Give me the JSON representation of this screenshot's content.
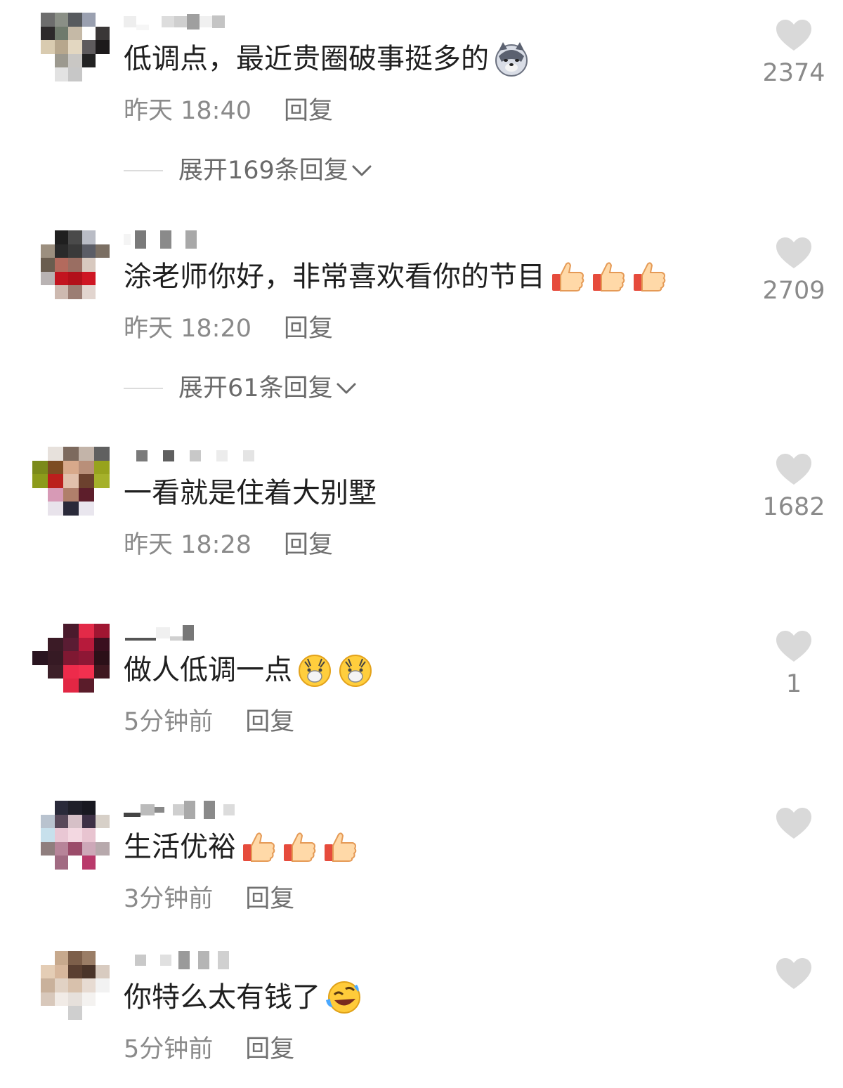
{
  "comments": [
    {
      "text": "低调点，最近贵圈破事挺多的",
      "emoji": [
        "doge-emoji"
      ],
      "time": "昨天 18:40",
      "reply_label": "回复",
      "likes": "2374",
      "expand_label": "展开169条回复"
    },
    {
      "text": "涂老师你好，非常喜欢看你的节目",
      "emoji": [
        "thumbs-up-emoji",
        "thumbs-up-emoji",
        "thumbs-up-emoji"
      ],
      "time": "昨天 18:20",
      "reply_label": "回复",
      "likes": "2709",
      "expand_label": "展开61条回复"
    },
    {
      "text": "一看就是住着大别墅",
      "emoji": [],
      "time": "昨天 18:28",
      "reply_label": "回复",
      "likes": "1682"
    },
    {
      "text": "做人低调一点",
      "emoji": [
        "shocked-emoji",
        "shocked-emoji"
      ],
      "time": "5分钟前",
      "reply_label": "回复",
      "likes": "1"
    },
    {
      "text": "生活优裕",
      "emoji": [
        "thumbs-up-emoji",
        "thumbs-up-emoji",
        "thumbs-up-emoji"
      ],
      "time": "3分钟前",
      "reply_label": "回复",
      "likes": ""
    },
    {
      "text": "你特么太有钱了",
      "emoji": [
        "laughing-emoji"
      ],
      "time": "5分钟前",
      "reply_label": "回复",
      "likes": ""
    }
  ],
  "colors": {
    "text": "#1f1f1f",
    "meta": "#8a8a8a",
    "heart": "#d9d9d9"
  }
}
